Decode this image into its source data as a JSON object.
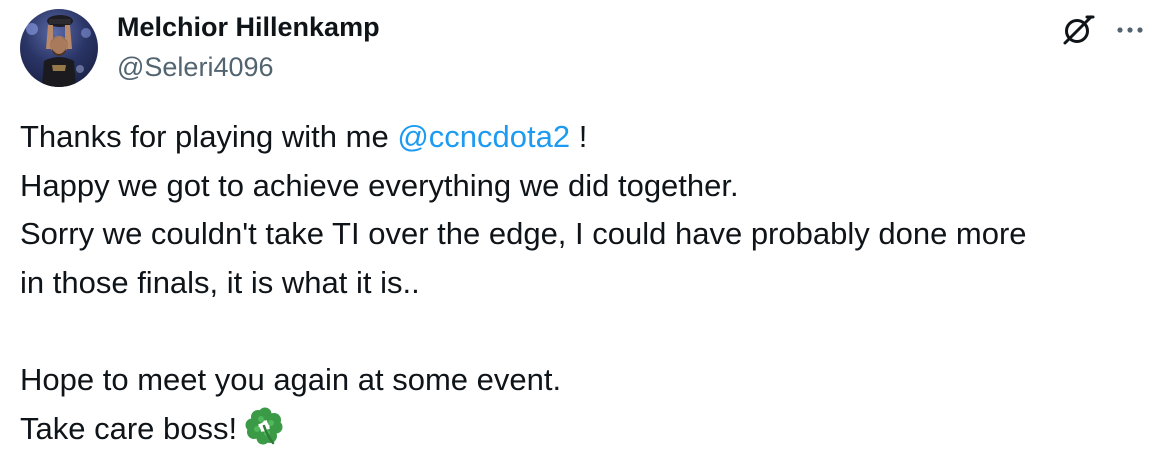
{
  "author": {
    "display_name": "Melchior Hillenkamp",
    "handle": "@Seleri4096"
  },
  "icons": {
    "grok": "grok-icon",
    "more": "more-options-icon",
    "clover": "four-leaf-clover-emoji"
  },
  "colors": {
    "text": "#0f1419",
    "secondary": "#536471",
    "link": "#1d9bf0",
    "clover": "#3a9a45"
  },
  "tweet": {
    "line1_before": "Thanks for playing with me ",
    "mention": "@ccncdota2",
    "line1_after": " !",
    "line2": "Happy we got to achieve everything we did together.",
    "line3": "Sorry we couldn't take TI over the edge, I could have probably done more",
    "line4": "in those finals, it is what it is..",
    "line5": "Hope to meet you again at some event.",
    "line6": "Take care boss!"
  }
}
